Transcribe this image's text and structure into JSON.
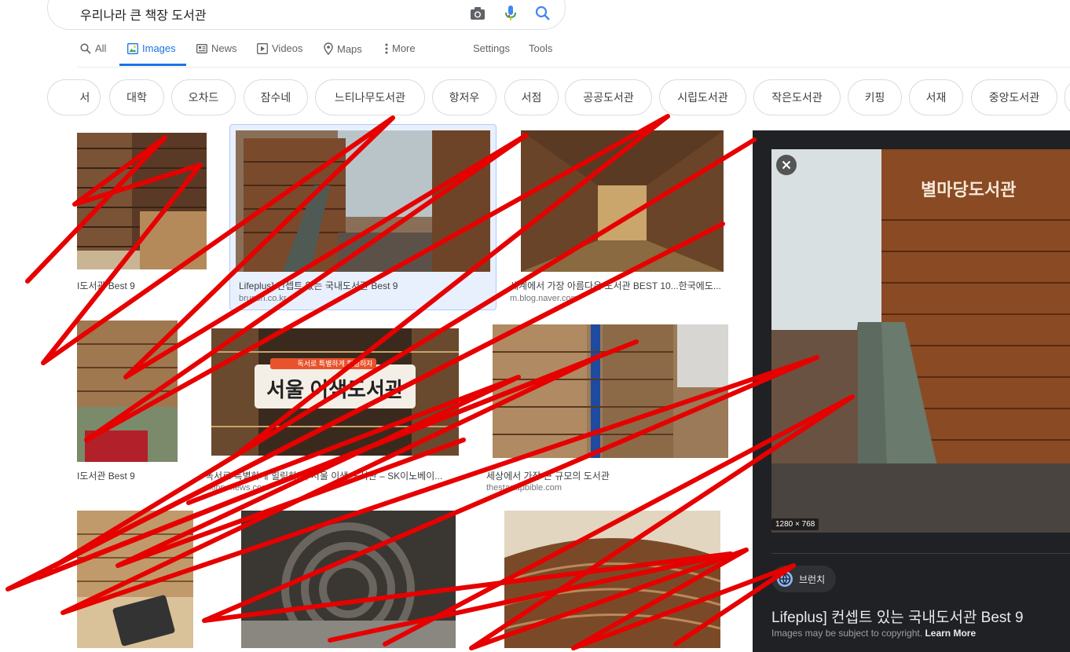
{
  "search": {
    "query": "우리나라 큰 책장 도서관",
    "camera_icon": "camera-icon",
    "mic_icon": "mic-icon",
    "search_icon": "search-icon"
  },
  "tabs": [
    {
      "label": "All",
      "icon": "search-icon"
    },
    {
      "label": "Images",
      "icon": "image-icon",
      "active": true
    },
    {
      "label": "News",
      "icon": "news-icon"
    },
    {
      "label": "Videos",
      "icon": "play-icon"
    },
    {
      "label": "Maps",
      "icon": "map-pin-icon"
    },
    {
      "label": "More",
      "icon": "more-vert-icon"
    },
    {
      "label": "Settings"
    },
    {
      "label": "Tools"
    }
  ],
  "chips": [
    "서",
    "대학",
    "오차드",
    "잠수네",
    "느티나무도서관",
    "항저우",
    "서점",
    "공공도서관",
    "시립도서관",
    "작은도서관",
    "키핑",
    "서재",
    "중앙도서관"
  ],
  "results": {
    "r1": {
      "caption": "I도서관 Best 9"
    },
    "r2": {
      "caption": "Lifeplus] 컨셉트 있는 국내도서관 Best 9",
      "source": "brunch.co.kr"
    },
    "r3": {
      "caption": "세계에서 가장 아름다운 도서관 BEST 10...한국에도...",
      "source": "m.blog.naver.com"
    },
    "r4": {
      "caption": "I도서관 Best 9"
    },
    "r5": {
      "caption": "독서로 특별하게 힐링하자, 서울 이색 도서관 – SK이노베이...",
      "source": "skinnonews.com",
      "sign_text": "서울 이색도서관",
      "sign_sub": "독서로 특별하게 힐링하자"
    },
    "r6": {
      "caption": "세상에서 가장 큰 규모의 도서관",
      "source": "thestartupbible.com"
    },
    "r7": {},
    "r8": {},
    "r9": {}
  },
  "panel": {
    "image_sign": "별마당도서관",
    "dimensions": "1280 × 768",
    "source_name": "브런치",
    "title": "Lifeplus] 컨셉트 있는 국내도서관 Best 9",
    "copyright": "Images may be subject to copyright.",
    "learn_more": "Learn More"
  },
  "colors": {
    "accent": "#1a73e8",
    "panel_bg": "#202124",
    "scribble": "#e60000"
  }
}
